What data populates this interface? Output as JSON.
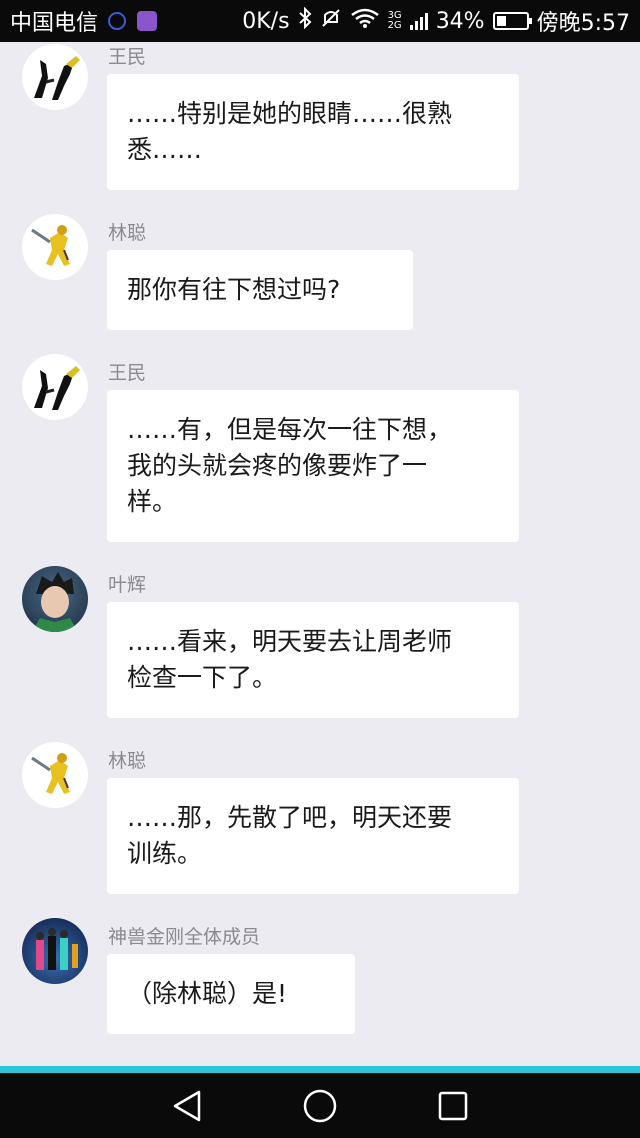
{
  "status_bar": {
    "carrier": "中国电信",
    "speed": "0K/s",
    "net_top": "3G",
    "net_bottom": "2G",
    "battery": "34%",
    "battery_level": 0.34,
    "time": "傍晚5:57"
  },
  "messages": [
    {
      "sender": "王民",
      "avatar": "figure-duo-avatar",
      "text": "……特别是她的眼睛……很熟\n悉……"
    },
    {
      "sender": "林聪",
      "avatar": "yellow-robot-avatar",
      "text": "那你有往下想过吗?"
    },
    {
      "sender": "王民",
      "avatar": "figure-duo-avatar",
      "text": "……有，但是每次一往下想，\n我的头就会疼的像要炸了一\n样。"
    },
    {
      "sender": "叶辉",
      "avatar": "boy-portrait-avatar",
      "text": "……看来，明天要去让周老师\n检查一下了。"
    },
    {
      "sender": "林聪",
      "avatar": "yellow-robot-avatar",
      "text": "……那，先散了吧，明天还要\n训练。"
    },
    {
      "sender": "神兽金刚全体成员",
      "avatar": "group-avatar",
      "text": "（除林聪）是!"
    }
  ],
  "colors": {
    "background": "#ebebf1",
    "bubble": "#ffffff",
    "accent_line": "#2fc4d6"
  },
  "nav": {
    "back": "back-triangle-icon",
    "home": "home-circle-icon",
    "recents": "recents-square-icon"
  }
}
